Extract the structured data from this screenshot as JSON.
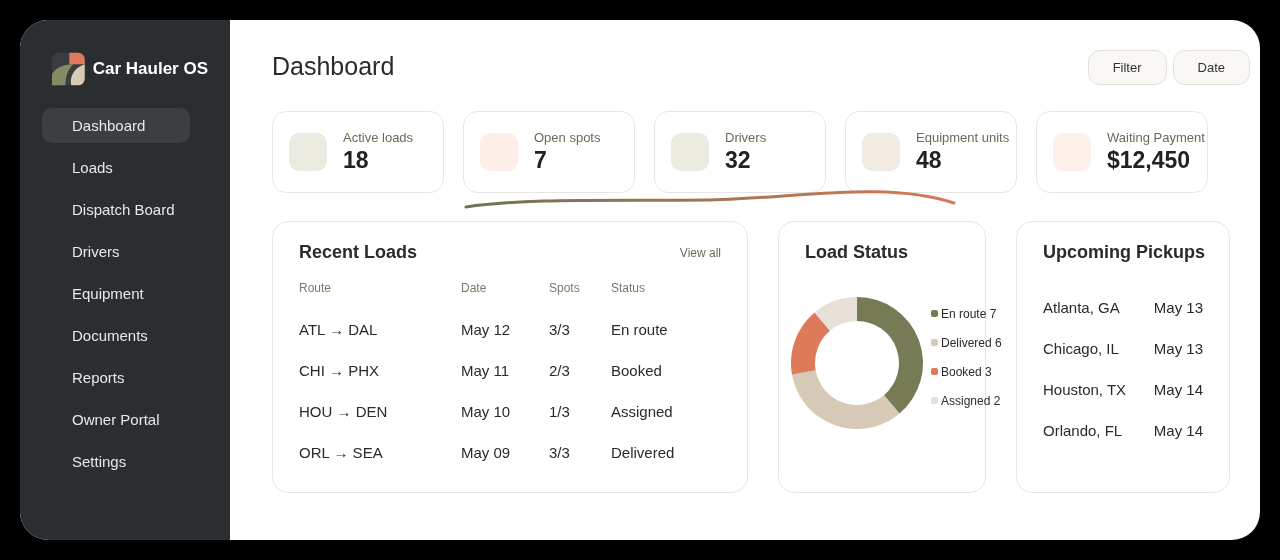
{
  "app": {
    "name": "Car Hauler OS"
  },
  "sidebar": {
    "items": [
      {
        "label": "Dashboard",
        "selected": true
      },
      {
        "label": "Loads",
        "selected": false
      },
      {
        "label": "Dispatch Board",
        "selected": false
      },
      {
        "label": "Drivers",
        "selected": false
      },
      {
        "label": "Equipment",
        "selected": false
      },
      {
        "label": "Documents",
        "selected": false
      },
      {
        "label": "Reports",
        "selected": false
      },
      {
        "label": "Owner Portal",
        "selected": false
      },
      {
        "label": "Settings",
        "selected": false
      }
    ]
  },
  "header": {
    "title": "Dashboard",
    "buttons": [
      "Filter",
      "Date"
    ]
  },
  "stats": [
    {
      "label": "Active loads",
      "value": "18",
      "color": "#ebebe1"
    },
    {
      "label": "Open spots",
      "value": "7",
      "color": "#fdeee7"
    },
    {
      "label": "Drivers",
      "value": "32",
      "color": "#ebebe1"
    },
    {
      "label": "Equipment units",
      "value": "48",
      "color": "#f1ebe4"
    },
    {
      "label": "Waiting Payment",
      "value": "$12,450",
      "color": "#fdf0ea"
    }
  ],
  "recent_loads": {
    "title": "Recent Loads",
    "link": "View all",
    "columns": [
      "Route",
      "Date",
      "Spots",
      "Status"
    ],
    "rows": [
      [
        "ATL → DAL",
        "May 12",
        "3/3",
        "En route"
      ],
      [
        "CHI → PHX",
        "May 11",
        "2/3",
        "Booked"
      ],
      [
        "HOU → DEN",
        "May 10",
        "1/3",
        "Assigned"
      ],
      [
        "ORL → SEA",
        "May 09",
        "3/3",
        "Delivered"
      ]
    ]
  },
  "load_status": {
    "title": "Load Status",
    "chart_data": {
      "type": "donut",
      "legend": "right",
      "categories": [
        "En route 7",
        "Delivered 6",
        "Booked 3",
        "Assigned 2"
      ],
      "values": [
        7,
        6,
        3,
        2
      ],
      "colors": [
        "#767a55",
        "#d6c9b5",
        "#dc7a5a",
        "#e6e0d8"
      ]
    }
  },
  "upcoming_pickups": {
    "title": "Upcoming Pickups",
    "items": [
      {
        "city": "Atlanta, GA",
        "date": "May 13"
      },
      {
        "city": "Chicago, IL",
        "date": "May 13"
      },
      {
        "city": "Houston, TX",
        "date": "May 14"
      },
      {
        "city": "Orlando, FL",
        "date": "May 14"
      }
    ]
  }
}
